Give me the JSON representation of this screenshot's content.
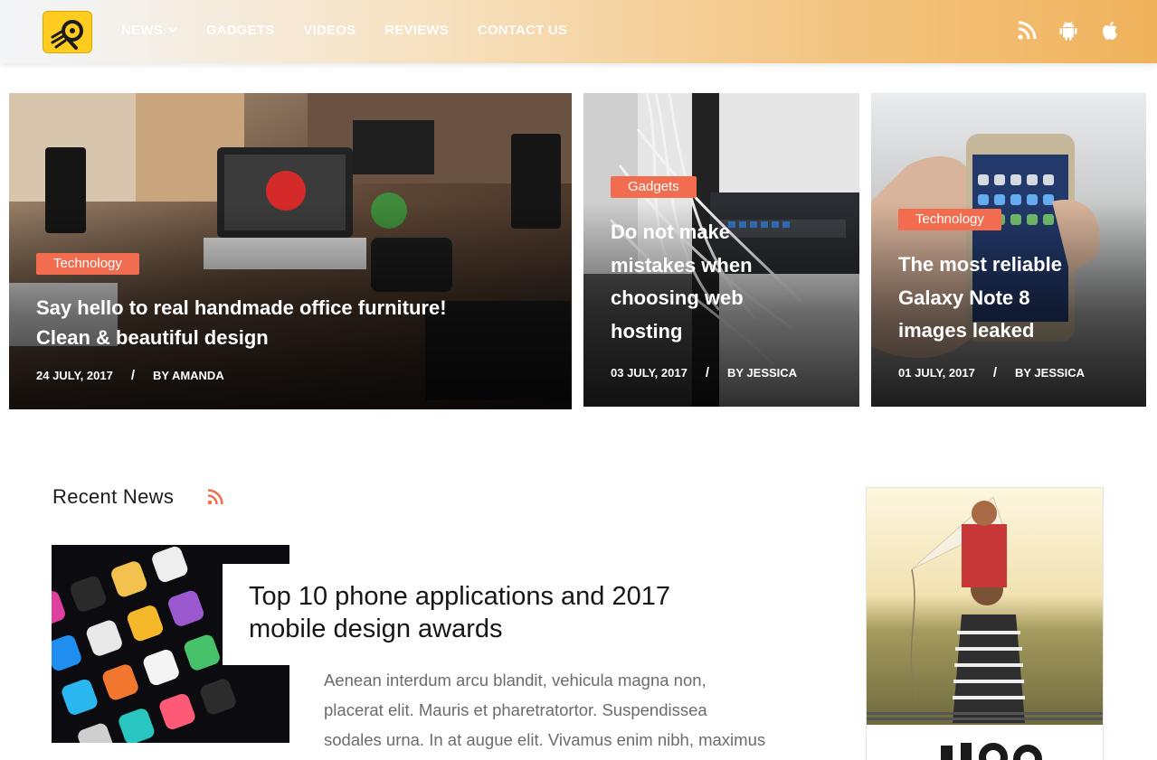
{
  "header": {
    "nav": [
      {
        "label": "NEWS",
        "has_dropdown": true
      },
      {
        "label": "GADGETS"
      },
      {
        "label": "VIDEOS"
      },
      {
        "label": "REVIEWS"
      },
      {
        "label": "CONTACT US"
      }
    ],
    "icons": [
      "rss-icon",
      "android-icon",
      "apple-icon"
    ]
  },
  "hero": [
    {
      "category": "Technology",
      "title_line1": "Say hello to real handmade office furniture!",
      "title_line2": "Clean & beautiful design",
      "date": "24 JULY, 2017",
      "author": "BY AMANDA"
    },
    {
      "category": "Gadgets",
      "title_lines": [
        "Do not make",
        "mistakes when",
        "choosing web",
        "hosting"
      ],
      "date": "03 JULY, 2017",
      "author": "BY JESSICA"
    },
    {
      "category": "Technology",
      "title_lines": [
        "The most reliable",
        "Galaxy Note 8",
        "images leaked"
      ],
      "date": "01 JULY, 2017",
      "author": "BY JESSICA"
    }
  ],
  "recent": {
    "heading": "Recent News",
    "title_line1": "Top 10 phone applications and 2017",
    "title_line2": "mobile design awards",
    "excerpt_lines": [
      "Aenean interdum arcu blandit, vehicula magna non,",
      "placerat elit. Mauris et pharetratortor. Suspendissea",
      "sodales urna. In at augue elit. Vivamus enim nibh, maximus"
    ]
  },
  "colors": {
    "accent": "#f26d4f",
    "logo_yellow": "#ffcc1f",
    "header_gradient_end": "#f0b25c"
  }
}
